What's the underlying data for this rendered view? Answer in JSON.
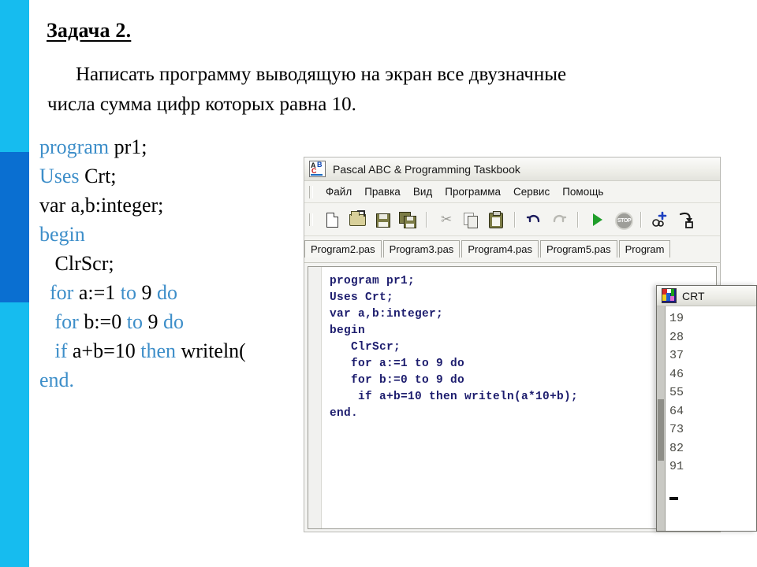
{
  "slide": {
    "task_title": "Задача 2.",
    "task_text_line1": "Написать программу выводящую на экран все двузначные",
    "task_text_line2": "числа сумма цифр которых равна 10."
  },
  "listing": {
    "lines": [
      {
        "parts": [
          {
            "t": "program",
            "k": true
          },
          {
            "t": " pr1;",
            "k": false
          }
        ]
      },
      {
        "parts": [
          {
            "t": "Uses",
            "k": true
          },
          {
            "t": " Crt;",
            "k": false
          }
        ]
      },
      {
        "parts": [
          {
            "t": "var a,b:integer;",
            "k": false
          }
        ]
      },
      {
        "parts": [
          {
            "t": "begin",
            "k": true
          }
        ]
      },
      {
        "parts": [
          {
            "t": "   ClrScr;",
            "k": false
          }
        ]
      },
      {
        "parts": [
          {
            "t": "  ",
            "k": false
          },
          {
            "t": "for",
            "k": true
          },
          {
            "t": " a:=1 ",
            "k": false
          },
          {
            "t": "to",
            "k": true
          },
          {
            "t": " 9 ",
            "k": false
          },
          {
            "t": "do",
            "k": true
          }
        ]
      },
      {
        "parts": [
          {
            "t": "   ",
            "k": false
          },
          {
            "t": "for",
            "k": true
          },
          {
            "t": " b:=0 ",
            "k": false
          },
          {
            "t": "to",
            "k": true
          },
          {
            "t": " 9 ",
            "k": false
          },
          {
            "t": "do",
            "k": true
          }
        ]
      },
      {
        "parts": [
          {
            "t": "   ",
            "k": false
          },
          {
            "t": "if",
            "k": true
          },
          {
            "t": " a+b=10 ",
            "k": false
          },
          {
            "t": "then",
            "k": true
          },
          {
            "t": " writeln(",
            "k": false
          }
        ]
      },
      {
        "parts": [
          {
            "t": "end.",
            "k": true
          }
        ]
      }
    ]
  },
  "pascal_window": {
    "title": "Pascal ABC & Programming Taskbook",
    "icon": "abc-spellcheck-icon",
    "menu": [
      "Файл",
      "Правка",
      "Вид",
      "Программа",
      "Сервис",
      "Помощь"
    ],
    "toolbar_icons": [
      "new-file-icon",
      "open-folder-icon",
      "save-icon",
      "save-all-icon",
      "cut-icon",
      "copy-icon",
      "paste-icon",
      "undo-icon",
      "redo-icon",
      "run-icon",
      "stop-icon",
      "add-task-icon",
      "submit-task-icon"
    ],
    "tabs": [
      "Program2.pas",
      "Program3.pas",
      "Program4.pas",
      "Program5.pas",
      "Program"
    ],
    "editor_code": "program pr1;\nUses Crt;\nvar a,b:integer;\nbegin\n   ClrScr;\n   for a:=1 to 9 do\n   for b:=0 to 9 do\n    if a+b=10 then writeln(a*10+b);\nend."
  },
  "crt_window": {
    "title": "CRT",
    "icon": "crt-colors-icon",
    "output": "19\n28\n37\n46\n55\n64\n73\n82\n91"
  },
  "colors": {
    "sidebar_cyan": "#16BCEF",
    "sidebar_blue": "#0A6FD1",
    "keyword_blue": "#3D8EC9",
    "editor_code": "#1D1D6E",
    "crt_text": "#4A4A44"
  }
}
